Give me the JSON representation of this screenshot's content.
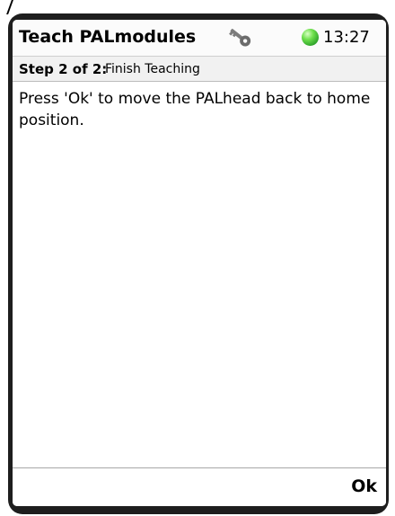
{
  "header": {
    "title": "Teach PALmodules",
    "time": "13:27",
    "key_icon": "key-icon",
    "status_icon": "status-indicator-icon",
    "status_color": "#3fbf2e"
  },
  "step": {
    "label": "Step 2 of 2:",
    "title": "Finish Teaching"
  },
  "content": {
    "message": "Press 'Ok' to move the PALhead back to home position."
  },
  "footer": {
    "ok_label": "Ok"
  }
}
